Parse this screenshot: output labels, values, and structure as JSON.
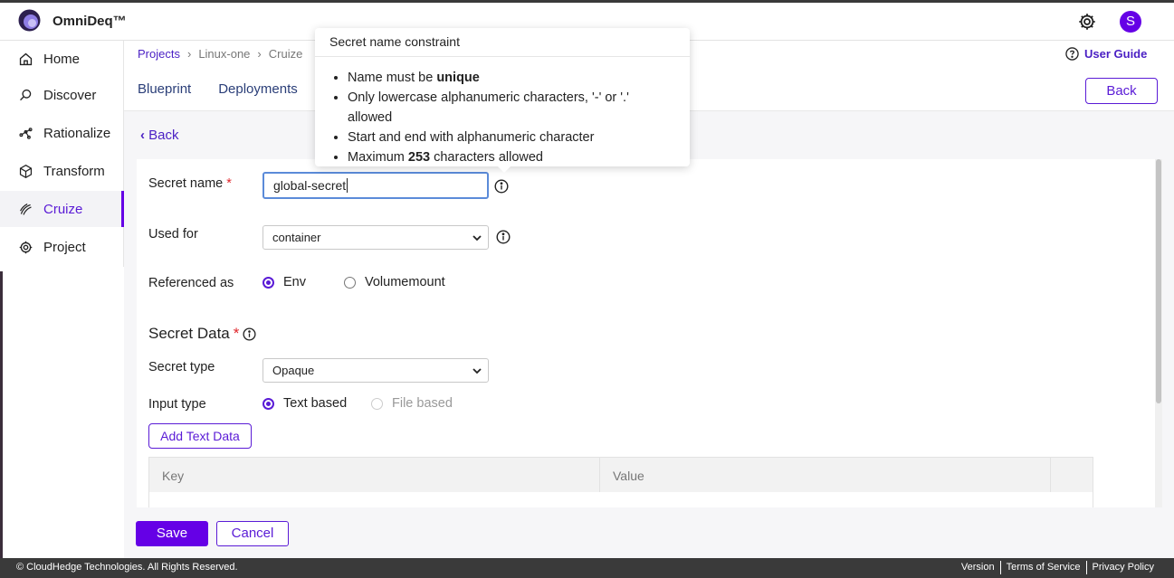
{
  "app": {
    "title": "OmniDeq™",
    "avatar_initial": "S"
  },
  "sidebar": {
    "items": [
      {
        "label": "Home",
        "icon": "home-icon"
      },
      {
        "label": "Discover",
        "icon": "discover-icon"
      },
      {
        "label": "Rationalize",
        "icon": "rationalize-icon"
      },
      {
        "label": "Transform",
        "icon": "cube-icon"
      },
      {
        "label": "Cruize",
        "icon": "cruize-icon",
        "active": true
      },
      {
        "label": "Project",
        "icon": "gear-icon"
      }
    ]
  },
  "breadcrumb": {
    "items": [
      "Projects",
      "Linux-one",
      "Cruize"
    ]
  },
  "header": {
    "user_guide": "User Guide",
    "back": "Back",
    "tabs": [
      "Blueprint",
      "Deployments"
    ]
  },
  "page": {
    "back_link": "Back"
  },
  "form": {
    "secret_name_label": "Secret name",
    "secret_name_value": "global-secret",
    "required_mark": "*",
    "used_for_label": "Used for",
    "used_for_value": "container",
    "referenced_as_label": "Referenced as",
    "referenced_as_options": [
      "Env",
      "Volumemount"
    ],
    "secret_data_title": "Secret Data",
    "secret_type_label": "Secret type",
    "secret_type_value": "Opaque",
    "input_type_label": "Input type",
    "input_type_options": [
      "Text based",
      "File based"
    ],
    "add_text_data": "Add Text Data",
    "table_headers": [
      "Key",
      "Value"
    ]
  },
  "actions": {
    "save": "Save",
    "cancel": "Cancel"
  },
  "footer": {
    "copyright": "© CloudHedge Technologies. All Rights Reserved.",
    "links": [
      "Version",
      "Terms of Service",
      "Privacy Policy"
    ]
  },
  "tooltip": {
    "title": "Secret name constraint",
    "rule1_prefix": "Name must be ",
    "rule1_bold": "unique",
    "rule2": "Only lowercase alphanumeric characters, '-' or '.' allowed",
    "rule3": "Start and end with alphanumeric character",
    "rule4_prefix": "Maximum ",
    "rule4_bold": "253",
    "rule4_suffix": " characters allowed"
  },
  "colors": {
    "accent": "#6500e6",
    "link": "#4a1fc4",
    "footer_bg": "#3a3a3a"
  }
}
